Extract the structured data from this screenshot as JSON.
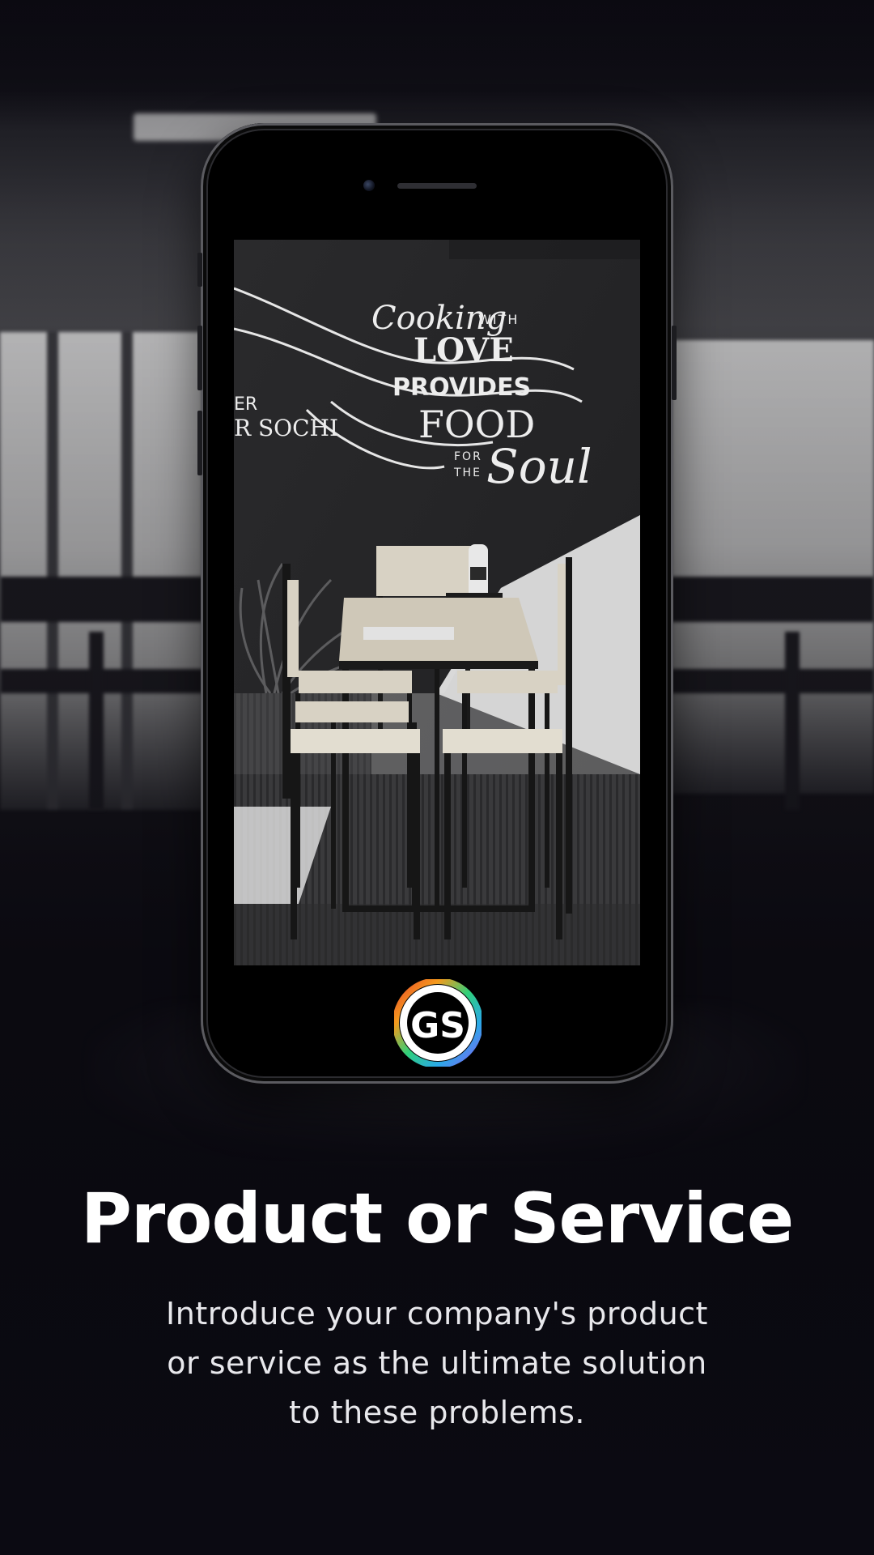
{
  "slide": {
    "title": "Product or Service",
    "body": "Introduce your company's product or service as the ultimate solution to these problems."
  },
  "phone_screen": {
    "chalkboard": {
      "line1": "Cooking",
      "line2": "WITH",
      "line3": "LOVE",
      "line4": "PROVIDES",
      "line5": "FOOD",
      "line6": "FOR",
      "line7": "THE",
      "line8": "Soul",
      "side_text_1": "ER",
      "side_text_2": "R SOCHI"
    }
  },
  "logo": {
    "text": "GS",
    "ring_colors": [
      "#e8452c",
      "#f59a1c",
      "#2fd07a",
      "#2aa9e8",
      "#8a5cf5",
      "#d94bd0"
    ]
  },
  "colors": {
    "background": "#0b0a12",
    "title": "#ffffff",
    "body": "#e8e8ec"
  }
}
